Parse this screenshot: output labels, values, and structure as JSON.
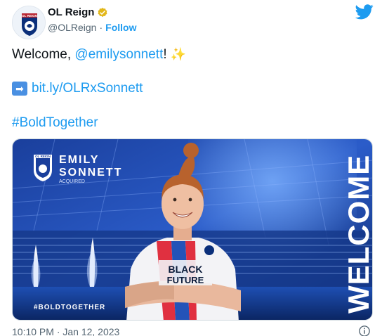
{
  "account": {
    "display_name": "OL Reign",
    "handle": "@OLReign",
    "separator": "·",
    "follow_label": "Follow",
    "avatar_text": "OL REIGN"
  },
  "tweet": {
    "welcome_prefix": "Welcome, ",
    "mention": "@emilysonnett",
    "welcome_suffix": "!",
    "sparkle_emoji": "✨",
    "arrow_emoji": "➡",
    "link": "bit.ly/OLRxSonnett",
    "hashtag": "#BoldTogether"
  },
  "media": {
    "player_first": "EMILY",
    "player_last": "SONNETT",
    "status": "ACQUIRED",
    "badge_text": "OL REIGN",
    "vertical_word": "WELCOME",
    "bottom_hashtag": "#BOLDTOGETHER",
    "jersey_line1": "BLACK",
    "jersey_line2": "FUTURE"
  },
  "footer": {
    "timestamp": "10:10 PM · Jan 12, 2023"
  },
  "colors": {
    "accent": "#1d9bf0",
    "navy": "#0b2f7a",
    "gold_verified": "#e2b719"
  },
  "icons": [
    "verified-icon",
    "twitter-bird-icon",
    "arrow-right-emoji-icon",
    "sparkles-emoji-icon",
    "info-icon"
  ]
}
